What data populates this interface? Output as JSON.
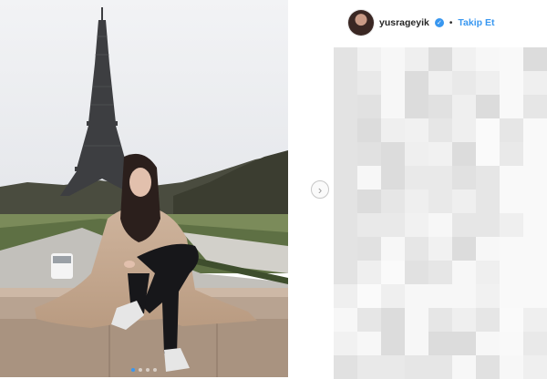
{
  "post": {
    "image_alt": "Woman sitting on a stone ledge in front of the Eiffel Tower",
    "carousel": {
      "count": 4,
      "active": 0
    }
  },
  "header": {
    "username": "yusrageyik",
    "verified_icon": "verified-badge-icon",
    "separator": "•",
    "follow_label": "Takip Et"
  },
  "nav": {
    "next_icon": "chevron-right-icon",
    "next_glyph": "›"
  },
  "colors": {
    "accent": "#3897f0",
    "text": "#262626",
    "sky": "#e9ebee"
  }
}
